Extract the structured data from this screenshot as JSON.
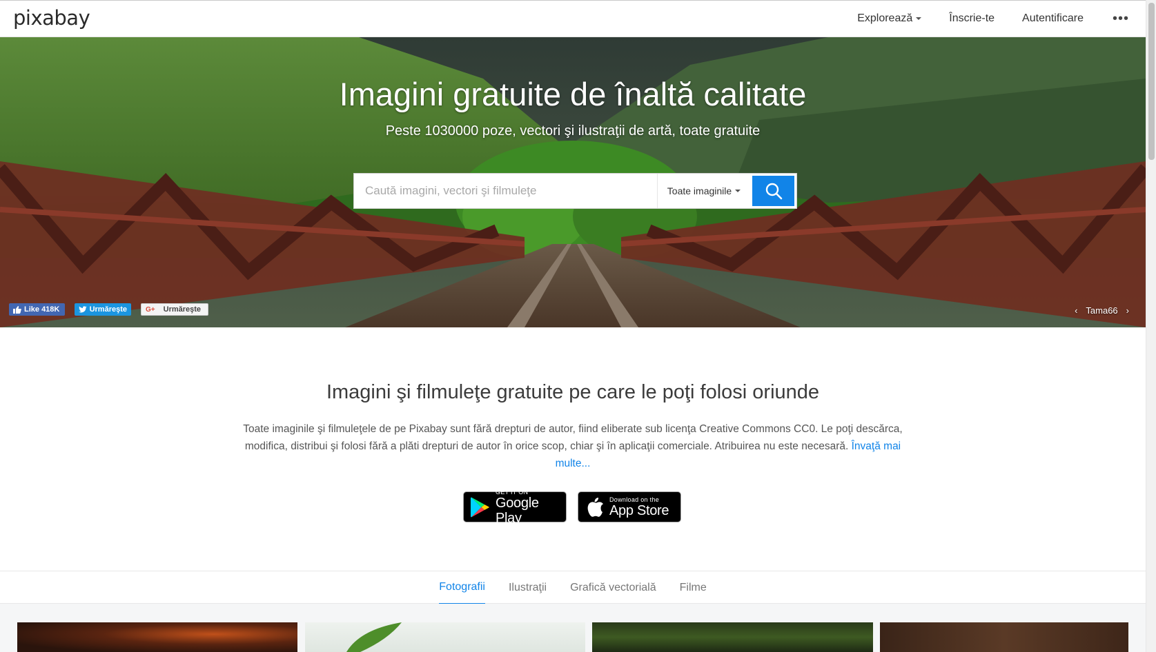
{
  "header": {
    "logo": "pixabay",
    "nav": {
      "explore": "Explorează",
      "signup": "Înscrie-te",
      "login": "Autentificare",
      "more": "•••"
    }
  },
  "hero": {
    "title": "Imagini gratuite de înaltă calitate",
    "subtitle": "Peste 1030000 poze, vectori şi ilustraţii de artă, toate gratuite",
    "search": {
      "placeholder": "Caută imagini, vectori şi filmuleţe",
      "value": "",
      "type_selected": "Toate imaginile"
    },
    "social": {
      "facebook": "Like 418K",
      "twitter": "Urmăreşte",
      "googleplus": "Urmăreşte"
    },
    "credit": {
      "prev": "‹",
      "author": "Tama66",
      "next": "›"
    }
  },
  "intro": {
    "title": "Imagini şi filmuleţe gratuite pe care le poţi folosi oriunde",
    "text": "Toate imaginile şi filmuleţele de pe Pixabay sunt fără drepturi de autor, fiind eliberate sub licenţa Creative Commons CC0. Le poţi descărca, modifica, distribui şi folosi fără a plăti drepturi de autor în orice scop, chiar şi în aplicaţii comerciale. Atribuirea nu este necesară.",
    "link": "Învaţă mai multe...",
    "badges": {
      "google_small": "GET IT ON",
      "google_big": "Google Play",
      "apple_small": "Download on the",
      "apple_big": "App Store"
    }
  },
  "tabs": [
    {
      "label": "Fotografii",
      "active": true
    },
    {
      "label": "Ilustraţii",
      "active": false
    },
    {
      "label": "Grafică vectorială",
      "active": false
    },
    {
      "label": "Filme",
      "active": false
    }
  ],
  "colors": {
    "accent": "#1184e8",
    "facebook": "#4267b2",
    "twitter": "#1b95e0"
  },
  "icons": [
    "search-icon",
    "thumbs-up-icon",
    "twitter-bird-icon",
    "google-plus-icon",
    "google-play-icon",
    "apple-icon",
    "caret-down-icon",
    "more-dots-icon"
  ]
}
